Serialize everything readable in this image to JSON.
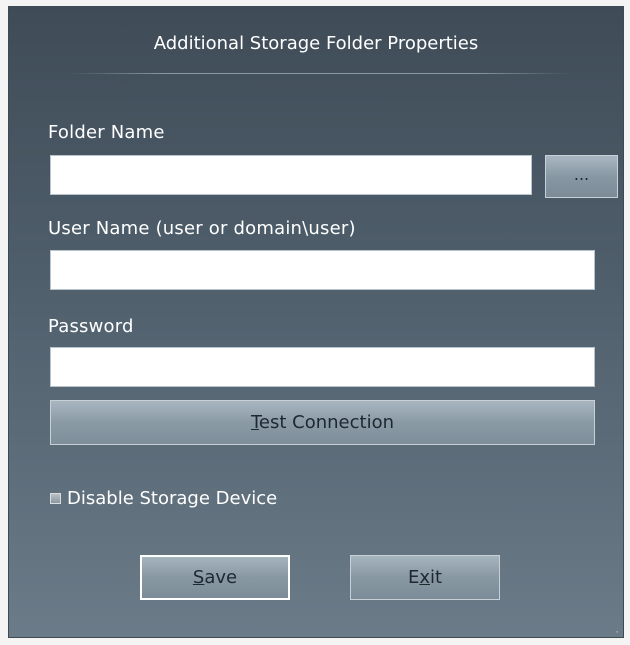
{
  "dialog": {
    "title": "Additional Storage Folder Properties"
  },
  "folder": {
    "label": "Folder Name",
    "value": "",
    "browse_label": "..."
  },
  "user": {
    "label": "User Name (user or domain\\user)",
    "value": ""
  },
  "password": {
    "label": "Password",
    "value": ""
  },
  "test_connection": {
    "label_prefix": "",
    "label_accel": "T",
    "label_rest": "est Connection"
  },
  "disable_storage": {
    "label": "Disable Storage Device",
    "checked": false
  },
  "save": {
    "label_accel": "S",
    "label_rest": "ave"
  },
  "exit": {
    "label_prefix": "E",
    "label_accel": "x",
    "label_rest": "it"
  },
  "colors": {
    "background_top": "#3f4c58",
    "background_bottom": "#6b7b88",
    "button_face": "#8a9aa5",
    "text": "#ffffff"
  }
}
